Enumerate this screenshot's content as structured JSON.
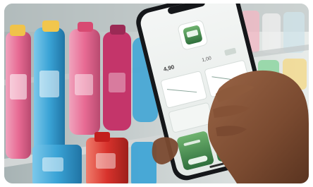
{
  "photo": {
    "subject": "hand-holding-smartphone-in-supermarket-aisle",
    "screen": {
      "price_main": "4,90",
      "price_secondary": "1,00"
    },
    "colors": {
      "app_green": "#3f8a4e",
      "app_green_light": "#6fb36f",
      "phone_body": "#15171a",
      "shelf_pink": "#e5678f",
      "shelf_blue": "#3aa3d6",
      "shelf_red": "#d8322c",
      "background_aisle": "#d9e3e0"
    }
  }
}
